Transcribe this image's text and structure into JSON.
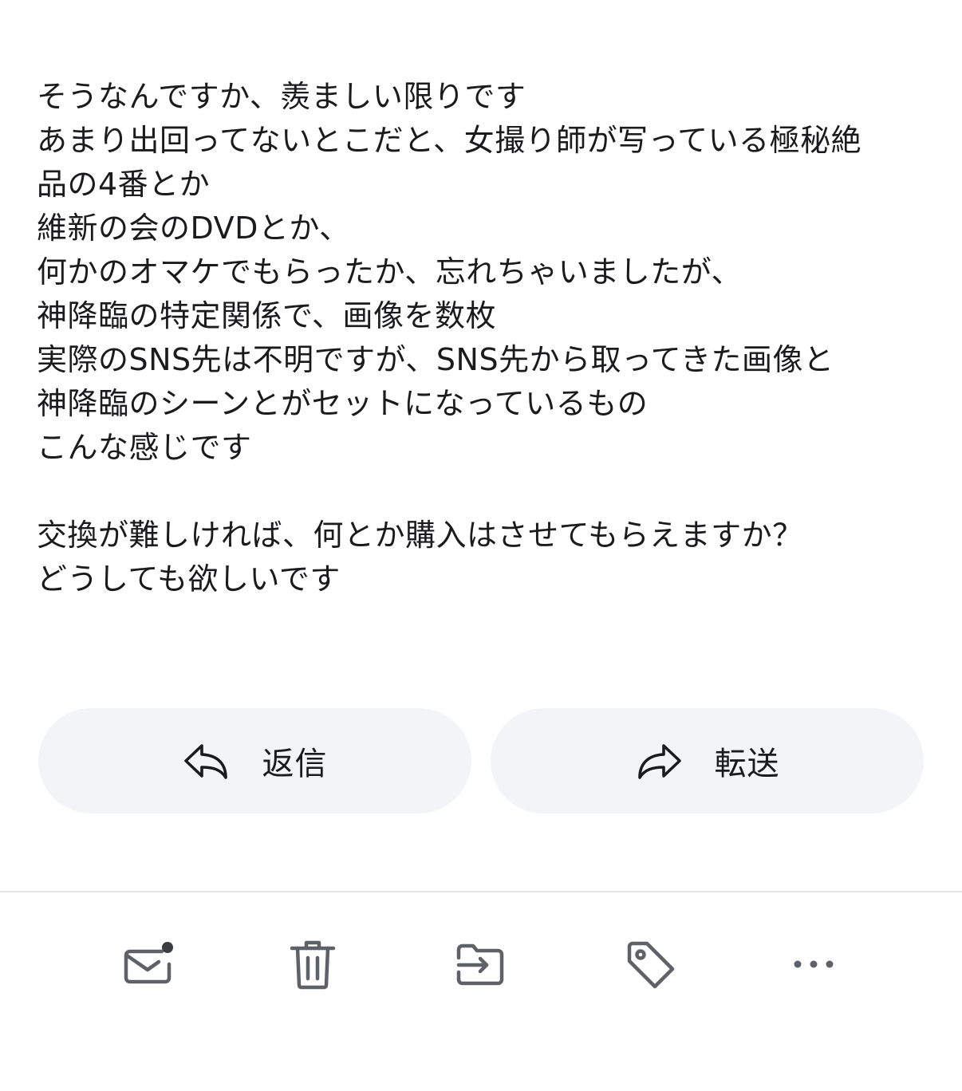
{
  "message": {
    "lines": [
      "そうなんですか、羨ましい限りです",
      "あまり出回ってないとこだと、女撮り師が写っている極秘絶",
      "品の4番とか",
      "維新の会のDVDとか、",
      "何かのオマケでもらったか、忘れちゃいましたが、",
      "神降臨の特定関係で、画像を数枚",
      "実際のSNS先は不明ですが、SNS先から取ってきた画像と",
      "神降臨のシーンとがセットになっているもの",
      "こんな感じです",
      "",
      "交換が難しければ、何とか購入はさせてもらえますか？",
      "どうしても欲しいです"
    ]
  },
  "actions": {
    "reply_label": "返信",
    "forward_label": "転送",
    "reply_icon": "reply-arrow-icon",
    "forward_icon": "forward-arrow-icon"
  },
  "toolbar": {
    "items": [
      {
        "name": "mark-unread",
        "icon": "envelope-unread-icon"
      },
      {
        "name": "delete",
        "icon": "trash-icon"
      },
      {
        "name": "move",
        "icon": "move-to-folder-icon"
      },
      {
        "name": "label",
        "icon": "tag-icon"
      },
      {
        "name": "more",
        "icon": "more-horizontal-icon"
      }
    ]
  },
  "colors": {
    "text": "#1b1b1d",
    "button_bg": "#f3f4f7",
    "icon": "#5f6168",
    "divider": "#e6e7ea"
  }
}
